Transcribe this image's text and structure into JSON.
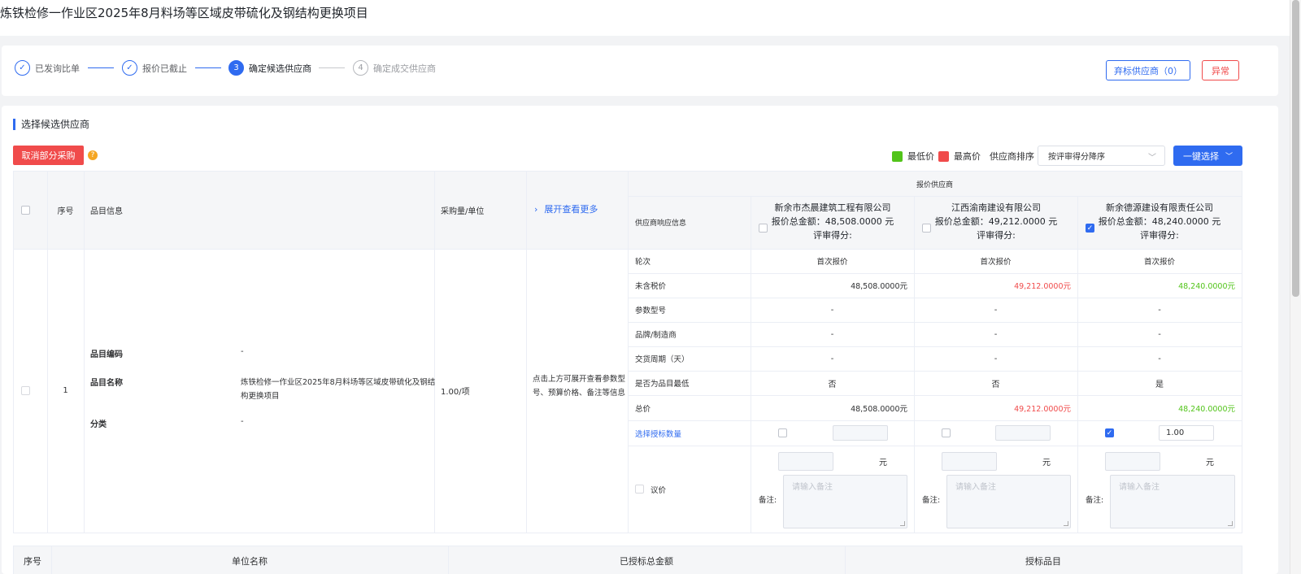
{
  "page_title": "炼铁检修一作业区2025年8月料场等区域皮带硫化及钢结构更换项目",
  "steps": [
    {
      "label": "已发询比单",
      "icon": "check-icon",
      "status": "done"
    },
    {
      "label": "报价已截止",
      "icon": "check-icon",
      "status": "done"
    },
    {
      "label": "确定候选供应商",
      "number": "3",
      "status": "active"
    },
    {
      "label": "确定成交供应商",
      "number": "4",
      "status": "pending"
    }
  ],
  "header_buttons": {
    "abandon": "弃标供应商（0）",
    "exception": "异常"
  },
  "section_title": "选择候选供应商",
  "toolbar": {
    "cancel_label": "取消部分采购",
    "help_icon": "question-icon",
    "legend_low": "最低价",
    "legend_high": "最高价",
    "sort_label": "供应商排序",
    "sort_value": "按评审得分降序",
    "one_click": "一键选择",
    "colors": {
      "low": "#52c41a",
      "high": "#f04b4b",
      "accent": "#2f6bf0"
    }
  },
  "table": {
    "headers": {
      "seq": "序号",
      "item_info": "品目信息",
      "qty_unit": "采购量/单位",
      "expand": "展开查看更多",
      "supplier_group": "报价供应商",
      "response_info": "供应商响应信息"
    },
    "suppliers": [
      {
        "name": "新余市杰晨建筑工程有限公司",
        "total": "报价总金额：48,508.0000 元",
        "score": "评审得分:",
        "checked": false
      },
      {
        "name": "江西渝南建设有限公司",
        "total": "报价总金额：49,212.0000 元",
        "score": "评审得分:",
        "checked": false
      },
      {
        "name": "新余德源建设有限责任公司",
        "total": "报价总金额：48,240.0000 元",
        "score": "评审得分:",
        "checked": true
      }
    ],
    "row": {
      "seq": "1",
      "code_label": "品目编码",
      "code_value": "-",
      "name_label": "品目名称",
      "name_value_line1": "炼铁检修一作业区2025年8月料场等区域皮带硫化及钢结",
      "name_value_line2": "构更换项目",
      "category_label": "分类",
      "category_value": "-",
      "qty": "1.00/项",
      "expand_hint_line1": "点击上方可展开查看参数型",
      "expand_hint_line2": "号、预算价格、备注等信息"
    },
    "attributes": [
      {
        "label": "轮次",
        "values": [
          "首次报价",
          "首次报价",
          "首次报价"
        ],
        "align": "center"
      },
      {
        "label": "未含税价",
        "values": [
          "48,508.0000元",
          "49,212.0000元",
          "48,240.0000元"
        ],
        "align": "right",
        "colors": [
          "",
          "red",
          "green"
        ]
      },
      {
        "label": "参数型号",
        "values": [
          "-",
          "-",
          "-"
        ],
        "align": "center"
      },
      {
        "label": "品牌/制造商",
        "values": [
          "-",
          "-",
          "-"
        ],
        "align": "center"
      },
      {
        "label": "交货周期（天）",
        "values": [
          "-",
          "-",
          "-"
        ],
        "align": "center"
      },
      {
        "label": "是否为品目最低",
        "values": [
          "否",
          "否",
          "是"
        ],
        "align": "center"
      },
      {
        "label": "总价",
        "values": [
          "48,508.0000元",
          "49,212.0000元",
          "48,240.0000元"
        ],
        "align": "right",
        "colors": [
          "",
          "red",
          "green"
        ]
      }
    ],
    "award_qty_label": "选择授标数量",
    "award_qty": [
      "",
      "",
      "1.00"
    ],
    "award_checked": [
      false,
      false,
      true
    ],
    "negotiate_label": "议价",
    "currency_unit": "元",
    "remark_label": "备注:",
    "remark_placeholder": "请输入备注"
  },
  "bottom_table": {
    "headers": [
      "序号",
      "单位名称",
      "已授标总金额",
      "授标品目"
    ]
  }
}
